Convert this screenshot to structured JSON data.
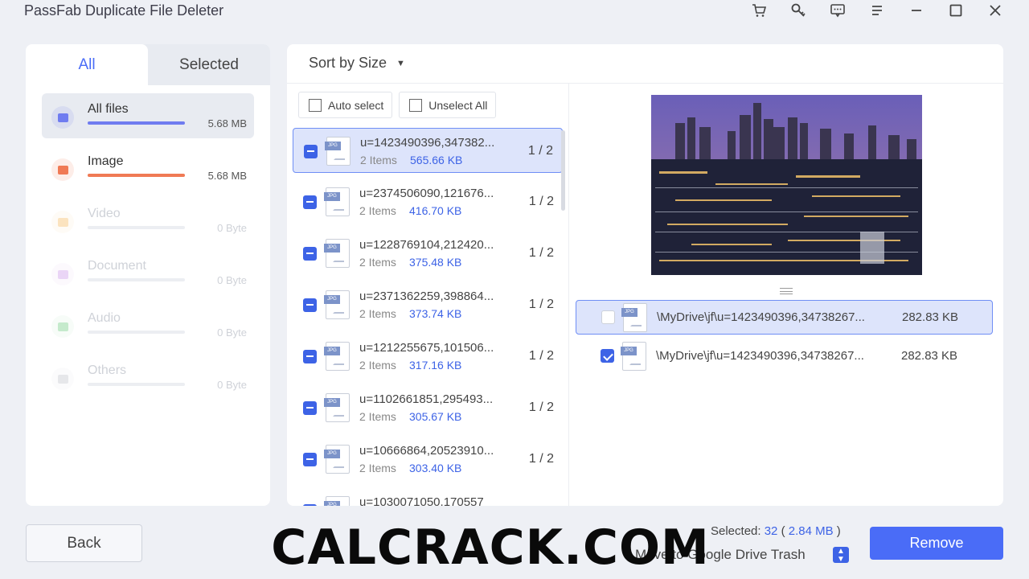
{
  "window": {
    "title": "PassFab Duplicate File Deleter"
  },
  "window_icons": [
    "cart-icon",
    "key-icon",
    "feedback-icon",
    "menu-icon",
    "minimize-icon",
    "maximize-icon",
    "close-icon"
  ],
  "tabs": {
    "all": "All",
    "selected": "Selected"
  },
  "categories": [
    {
      "label": "All files",
      "size": "5.68 MB",
      "icon": "folder-icon",
      "color": "#6f7cf0",
      "fill": 1.0
    },
    {
      "label": "Image",
      "size": "5.68 MB",
      "icon": "image-icon",
      "color": "#f07a55",
      "fill": 1.0
    },
    {
      "label": "Video",
      "size": "0 Byte",
      "icon": "video-icon",
      "color": "#f5b04b",
      "fill": 0
    },
    {
      "label": "Document",
      "size": "0 Byte",
      "icon": "document-icon",
      "color": "#c58ae8",
      "fill": 0
    },
    {
      "label": "Audio",
      "size": "0 Byte",
      "icon": "audio-icon",
      "color": "#5cc66e",
      "fill": 0
    },
    {
      "label": "Others",
      "size": "0 Byte",
      "icon": "others-icon",
      "color": "#b8bcc6",
      "fill": 0
    }
  ],
  "sort": {
    "label": "Sort by Size"
  },
  "actions": {
    "auto_select": "Auto select",
    "unselect_all": "Unselect All"
  },
  "groups": [
    {
      "name": "u=1423490396,347382...",
      "items": "2 Items",
      "size": "565.66 KB",
      "ratio": "1 / 2"
    },
    {
      "name": "u=2374506090,121676...",
      "items": "2 Items",
      "size": "416.70 KB",
      "ratio": "1 / 2"
    },
    {
      "name": "u=1228769104,212420...",
      "items": "2 Items",
      "size": "375.48 KB",
      "ratio": "1 / 2"
    },
    {
      "name": "u=2371362259,398864...",
      "items": "2 Items",
      "size": "373.74 KB",
      "ratio": "1 / 2"
    },
    {
      "name": "u=1212255675,101506...",
      "items": "2 Items",
      "size": "317.16 KB",
      "ratio": "1 / 2"
    },
    {
      "name": "u=1102661851,295493...",
      "items": "2 Items",
      "size": "305.67 KB",
      "ratio": "1 / 2"
    },
    {
      "name": "u=10666864,20523910...",
      "items": "2 Items",
      "size": "303.40 KB",
      "ratio": "1 / 2"
    },
    {
      "name": "u=1030071050,170557",
      "items": "",
      "size": "",
      "ratio": ""
    }
  ],
  "duplicates": [
    {
      "path": "\\MyDrive\\jf\\u=1423490396,34738267...",
      "size": "282.83 KB",
      "checked": false
    },
    {
      "path": "\\MyDrive\\jf\\u=1423490396,34738267...",
      "size": "282.83 KB",
      "checked": true
    }
  ],
  "file_tag": "JPG",
  "footer": {
    "back": "Back",
    "selected_label": "Selected:",
    "selected_count": "32",
    "selected_size": "2.84 MB",
    "move_to": "Move to Google Drive Trash",
    "remove": "Remove"
  },
  "watermark": "CALCRACK.COM"
}
